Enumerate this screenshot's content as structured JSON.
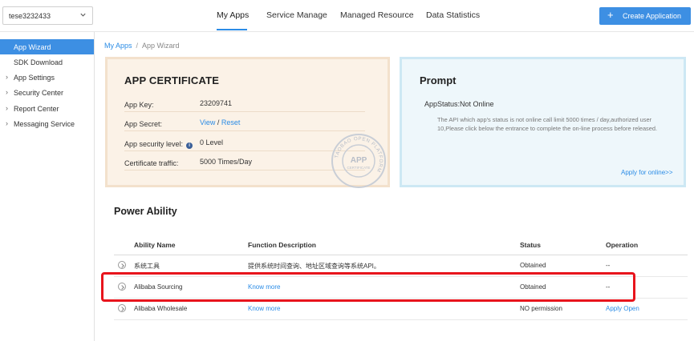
{
  "account": {
    "selected": "tese3232433"
  },
  "nav": {
    "tabs": [
      "My Apps",
      "Service Manage",
      "Managed Resource",
      "Data Statistics"
    ],
    "active": "My Apps",
    "create_button": "Create Application"
  },
  "sidebar": {
    "items": [
      {
        "label": "App Wizard",
        "active": true,
        "expandable": false
      },
      {
        "label": "SDK Download",
        "active": false,
        "expandable": false
      },
      {
        "label": "App Settings",
        "active": false,
        "expandable": true
      },
      {
        "label": "Security Center",
        "active": false,
        "expandable": true
      },
      {
        "label": "Report Center",
        "active": false,
        "expandable": true
      },
      {
        "label": "Messaging Service",
        "active": false,
        "expandable": true
      }
    ]
  },
  "breadcrumb": {
    "root": "My Apps",
    "separator": "/",
    "current": "App Wizard"
  },
  "certificate": {
    "title": "APP CERTIFICATE",
    "rows": [
      {
        "key": "App Key:",
        "value": "23209741"
      },
      {
        "key": "App Secret:",
        "view": "View",
        "slash": "/",
        "reset": "Reset"
      },
      {
        "key": "App security level:",
        "info_icon": "i",
        "value": "0 Level"
      },
      {
        "key": "Certificate traffic:",
        "value": "5000 Times/Day"
      }
    ],
    "seal": {
      "ring_text": "TAOBAO OPEN PLATFORM",
      "center_top": "APP",
      "center_bottom": "CERTIFICATE"
    }
  },
  "prompt": {
    "title": "Prompt",
    "status": "AppStatus:Not Online",
    "description": "The API which app's status is not online call limit 5000 times / day,authorized user 10,Please click below the entrance to complete the on-line process before released.",
    "apply_link": "Apply for online>>"
  },
  "power_ability": {
    "title": "Power Ability",
    "columns": [
      "Ability Name",
      "Function Description",
      "Status",
      "Operation"
    ],
    "rows": [
      {
        "name": "系统工具",
        "description": "提供系统时间查询、地址区域查询等系统API。",
        "description_is_link": false,
        "status": "Obtained",
        "operation": "--",
        "operation_is_link": false
      },
      {
        "name": "Alibaba Sourcing",
        "description": "Know more",
        "description_is_link": true,
        "status": "Obtained",
        "operation": "--",
        "operation_is_link": false
      },
      {
        "name": "Alibaba Wholesale",
        "description": "Know more",
        "description_is_link": true,
        "status": "NO permission",
        "operation": "Apply Open",
        "operation_is_link": true
      }
    ]
  },
  "colors": {
    "accent": "#3d8fe3",
    "link": "#2b8ce6",
    "highlight": "#e8141c",
    "cert_bg": "#fbf2e7",
    "prompt_bg": "#eef7fb"
  }
}
